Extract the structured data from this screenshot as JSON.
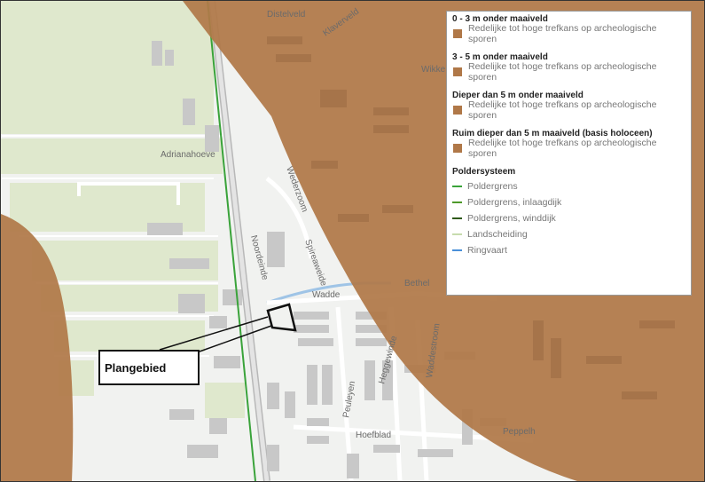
{
  "map": {
    "streets": [
      "Distelveld",
      "Klaverveld",
      "Wikke",
      "Adrianahoeve",
      "Wederzoom",
      "Noordeinde",
      "Spireaweide",
      "Wadde",
      "Bethel",
      "Heggewinde",
      "Waddestroom",
      "Peuleyen",
      "Hoefblad",
      "Peppelh",
      "Ringvaart",
      "Landscheiding"
    ],
    "colors": {
      "archeo_zone": "#b07848",
      "polder_green": "#3aa33a",
      "water": "#9fc4e6",
      "field": "#dfe8cd",
      "building": "#c8c8c8"
    }
  },
  "legend": {
    "groups": [
      {
        "title": "0 - 3 m onder maaiveld",
        "item": "Redelijke tot hoge trefkans op archeologische sporen"
      },
      {
        "title": "3 - 5 m onder maaiveld",
        "item": "Redelijke tot hoge trefkans op archeologische sporen"
      },
      {
        "title": "Dieper dan 5 m onder maaiveld",
        "item": "Redelijke tot hoge trefkans op archeologische sporen"
      },
      {
        "title": "Ruim dieper dan 5 m maaiveld (basis holoceen)",
        "item": "Redelijke tot hoge trefkans op archeologische sporen"
      }
    ],
    "polder": {
      "title": "Poldersysteem",
      "items": [
        {
          "label": "Poldergrens",
          "color": "#3aa33a"
        },
        {
          "label": "Poldergrens, inlaagdijk",
          "color": "#4e9a2a"
        },
        {
          "label": "Poldergrens, winddijk",
          "color": "#2f5a1a"
        },
        {
          "label": "Landscheiding",
          "color": "#c7dcae"
        },
        {
          "label": "Ringvaart",
          "color": "#4a90d9"
        }
      ]
    }
  },
  "callout": {
    "label": "Plangebied"
  }
}
